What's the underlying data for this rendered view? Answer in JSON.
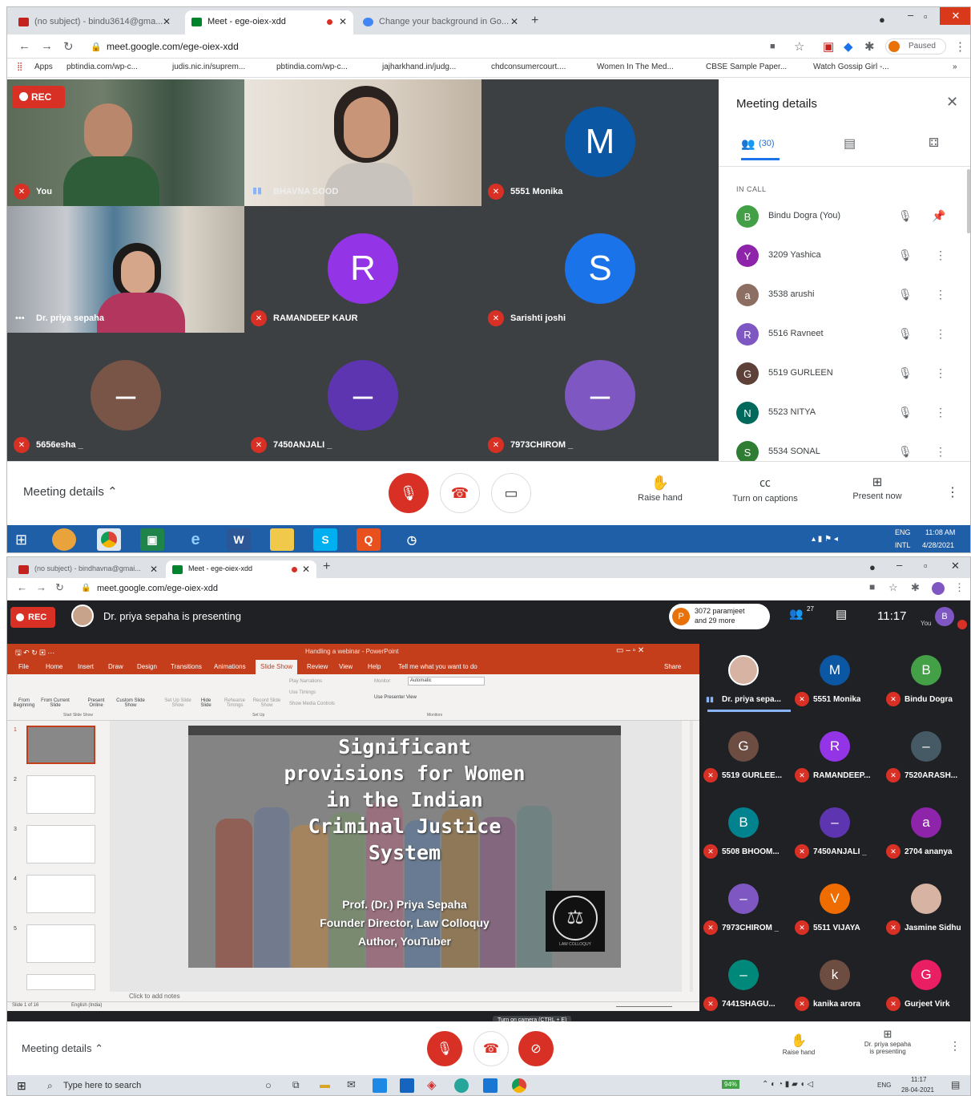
{
  "top": {
    "tabs": [
      {
        "label": "(no subject) - bindu3614@gma...",
        "fav": "gmail-icon",
        "color": "#c5221f"
      },
      {
        "label": "Meet - ege-oiex-xdd",
        "fav": "meet-icon",
        "color": "#00832d"
      },
      {
        "label": "Change your background in Go...",
        "fav": "google-icon",
        "color": "#4285f4"
      }
    ],
    "url": "meet.google.com/ege-oiex-xdd",
    "paused_label": "Paused",
    "bookmarks": [
      "Apps",
      "pbtindia.com/wp-c...",
      "judis.nic.in/suprem...",
      "pbtindia.com/wp-c...",
      "jajharkhand.in/judg...",
      "chdconsumercourt....",
      "Women In The Med...",
      "CBSE Sample Paper...",
      "Watch Gossip Girl -..."
    ],
    "rec_label": "REC",
    "tiles": [
      {
        "name": "You",
        "kind": "video"
      },
      {
        "name": "BHAVNA SOOD",
        "kind": "video"
      },
      {
        "name": "5551 Monika",
        "initial": "M",
        "color": "#0b57a4"
      },
      {
        "name": "Dr. priya sepaha",
        "kind": "video"
      },
      {
        "name": "RAMANDEEP KAUR",
        "initial": "R",
        "color": "#9334e6"
      },
      {
        "name": "Sarishti joshi",
        "initial": "S",
        "color": "#1a73e8"
      },
      {
        "name": "5656esha _",
        "initial": "–",
        "color": "#795548"
      },
      {
        "name": "7450ANJALI _",
        "initial": "–",
        "color": "#5e35b1"
      },
      {
        "name": "7973CHIROM _",
        "initial": "–",
        "color": "#7e57c2"
      }
    ],
    "panel": {
      "title": "Meeting details",
      "people_count": "(30)",
      "in_call": "IN CALL",
      "people": [
        {
          "initial": "B",
          "name": "Bindu Dogra (You)",
          "color": "#43a047"
        },
        {
          "initial": "Y",
          "name": "3209 Yashica",
          "color": "#8e24aa"
        },
        {
          "initial": "a",
          "name": "3538 arushi",
          "color": "#8d6e63"
        },
        {
          "initial": "R",
          "name": "5516 Ravneet",
          "color": "#7e57c2"
        },
        {
          "initial": "G",
          "name": "5519 GURLEEN",
          "color": "#5d4037"
        },
        {
          "initial": "N",
          "name": "5523 NITYA",
          "color": "#00695c"
        },
        {
          "initial": "S",
          "name": "5534 SONAL",
          "color": "#2e7d32"
        }
      ]
    },
    "bottom": {
      "meeting_details": "Meeting details",
      "raise_hand": "Raise hand",
      "captions": "Turn on captions",
      "present": "Present now"
    },
    "taskbar": {
      "lang": "ENG",
      "intl": "INTL",
      "time": "11:08 AM",
      "date": "4/28/2021"
    }
  },
  "bottom": {
    "tabs": [
      {
        "label": "(no subject) - bindhavna@gmai...",
        "color": "#c5221f"
      },
      {
        "label": "Meet - ege-oiex-xdd",
        "color": "#00832d"
      }
    ],
    "url": "meet.google.com/ege-oiex-xdd",
    "rec_label": "REC",
    "presenting": "Dr. priya sepaha is presenting",
    "joined_line1": "3072 paramjeet",
    "joined_line2": "and 29 more",
    "people_count": "27",
    "clock": "11:17",
    "you_label": "You",
    "ppt": {
      "title": "Handling a webinar - PowerPoint",
      "menu": [
        "File",
        "Home",
        "Insert",
        "Draw",
        "Design",
        "Transitions",
        "Animations",
        "Slide Show",
        "Review",
        "View",
        "Help",
        "Tell me what you want to do"
      ],
      "share": "Share",
      "ribbon": [
        "From Beginning",
        "From Current Slide",
        "Present Online",
        "Custom Slide Show",
        "Set Up Slide Show",
        "Hide Slide",
        "Rehearse Timings",
        "Record Slide Show",
        "Play Narrations",
        "Use Timings",
        "Show Media Controls",
        "Monitor:",
        "Automatic",
        "Use Presenter View"
      ],
      "groups": [
        "Start Slide Show",
        "Set Up",
        "Monitors"
      ],
      "notes": "Click to add notes",
      "status": "Slide 1 of 16",
      "language": "English (India)",
      "slide_title": [
        "Significant",
        "provisions for Women",
        "in the Indian",
        "Criminal Justice",
        "System"
      ],
      "slide_sub": [
        "Prof. (Dr.) Priya Sepaha",
        "Founder Director, Law Colloquy",
        "Author, YouTuber"
      ],
      "logo_text": "LAW COLLOQUY"
    },
    "tooltip": "Turn on camera (CTRL + E)",
    "grid": [
      {
        "name": "Dr. priya sepa...",
        "initial": "",
        "color": "#6d4c41",
        "photo": true,
        "speaking": true
      },
      {
        "name": "5551 Monika",
        "initial": "M",
        "color": "#0b57a4"
      },
      {
        "name": "Bindu Dogra",
        "initial": "B",
        "color": "#43a047"
      },
      {
        "name": "5519 GURLEE...",
        "initial": "G",
        "color": "#6d4c41"
      },
      {
        "name": "RAMANDEEP...",
        "initial": "R",
        "color": "#9334e6"
      },
      {
        "name": "7520ARASH...",
        "initial": "–",
        "color": "#455a64"
      },
      {
        "name": "5508 BHOOM...",
        "initial": "B",
        "color": "#00838f"
      },
      {
        "name": "7450ANJALI _",
        "initial": "–",
        "color": "#5e35b1"
      },
      {
        "name": "2704 ananya",
        "initial": "a",
        "color": "#8e24aa"
      },
      {
        "name": "7973CHIROM _",
        "initial": "–",
        "color": "#7e57c2"
      },
      {
        "name": "5511 VIJAYA",
        "initial": "V",
        "color": "#ef6c00"
      },
      {
        "name": "Jasmine Sidhu",
        "initial": "",
        "color": "#d7b3a3",
        "photo": true
      },
      {
        "name": "7441SHAGU...",
        "initial": "–",
        "color": "#00897b"
      },
      {
        "name": "kanika arora",
        "initial": "k",
        "color": "#6d4c41"
      },
      {
        "name": "Gurjeet Virk",
        "initial": "G",
        "color": "#e91e63"
      }
    ],
    "bar": {
      "meeting_details": "Meeting details",
      "raise_hand": "Raise hand",
      "presenting_line1": "Dr. priya sepaha",
      "presenting_line2": "is presenting"
    },
    "taskbar": {
      "search": "Type here to search",
      "battery": "94%",
      "lang": "ENG",
      "time": "11:17",
      "date": "28-04-2021"
    }
  }
}
